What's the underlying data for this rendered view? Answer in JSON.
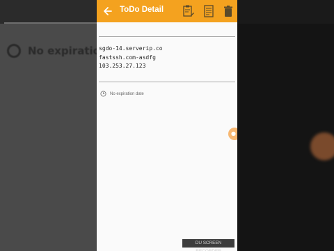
{
  "appbar": {
    "title": "ToDo Detail",
    "color": "#f4a21f",
    "icons": [
      "back-arrow-icon",
      "edit-note-icon",
      "save-document-icon",
      "delete-trash-icon"
    ]
  },
  "todo": {
    "lines": [
      "sgdo-14.serverip.co",
      "fastssh.com-asdfg",
      "103.253.27.123"
    ]
  },
  "expiration": {
    "label": "No expiration date"
  },
  "background": {
    "left_text": "No expiration"
  },
  "watermark": {
    "text": "DU SCREEN RECORDER"
  }
}
